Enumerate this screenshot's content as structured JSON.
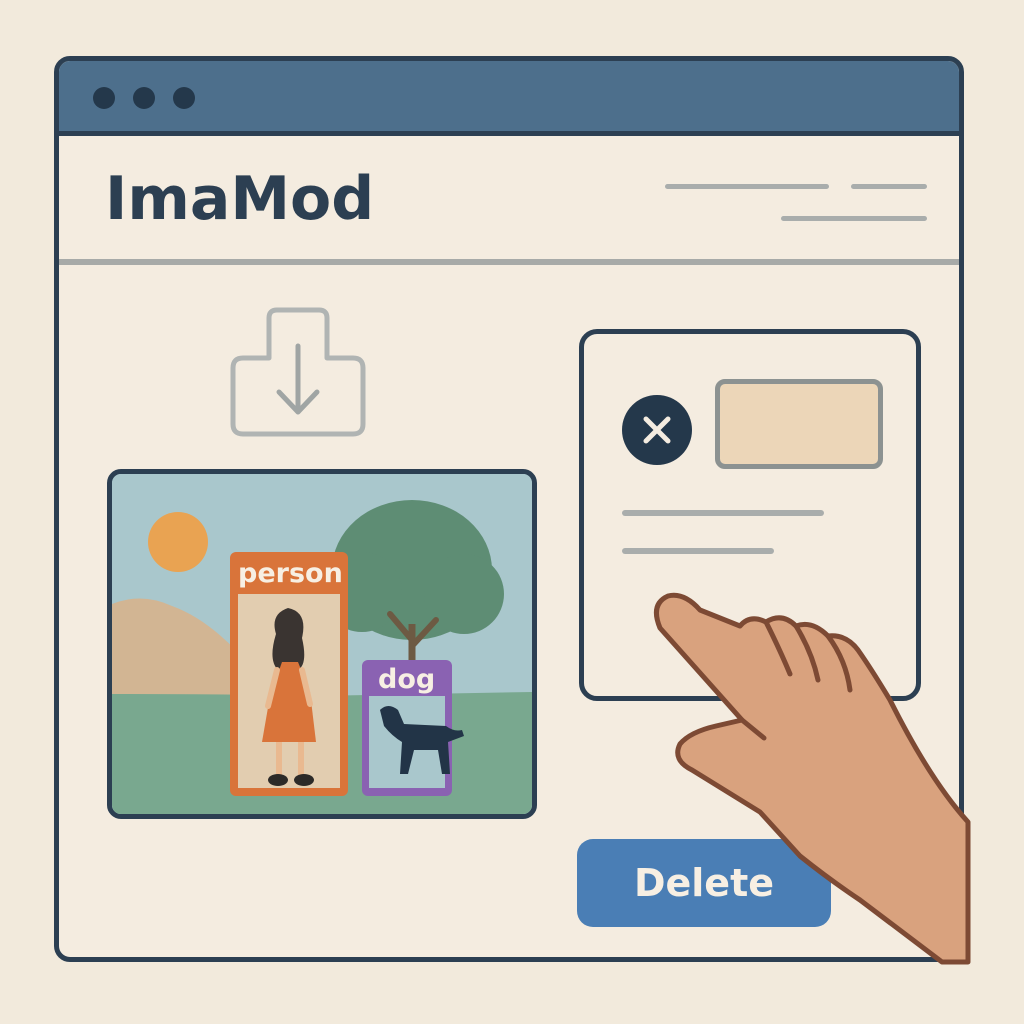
{
  "window": {
    "dots": [
      "window-dot",
      "window-dot",
      "window-dot"
    ]
  },
  "header": {
    "app_title": "ImaMod"
  },
  "icons": {
    "upload": "download-arrow-icon",
    "close": "close-icon",
    "sun": "sun-icon"
  },
  "detection": {
    "labels": [
      "person",
      "dog"
    ]
  },
  "dialog": {
    "action_label": "Delete"
  },
  "colors": {
    "titlebar": "#4d6f8c",
    "outline": "#2c3f52",
    "person_box": "#d9743a",
    "dog_box": "#8a62b2",
    "delete_button": "#4a7eb5",
    "background": "#f2eadc"
  }
}
